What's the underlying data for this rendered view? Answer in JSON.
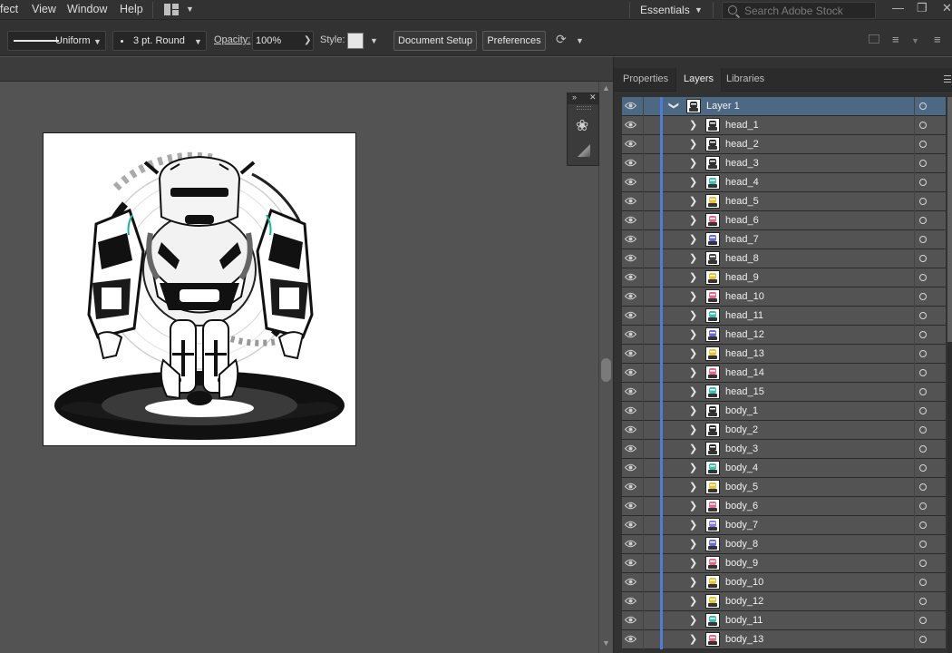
{
  "menubar": {
    "items": [
      "fect",
      "View",
      "Window",
      "Help"
    ],
    "workspace": "Essentials",
    "stock_search_placeholder": "Search Adobe Stock"
  },
  "control_bar": {
    "stroke_profile": "Uniform",
    "brush": "3 pt. Round",
    "opacity_label": "Opacity:",
    "opacity_value": "100%",
    "style_label": "Style:",
    "document_setup": "Document Setup",
    "preferences": "Preferences"
  },
  "panel": {
    "tabs": [
      "Properties",
      "Layers",
      "Libraries"
    ],
    "active_tab": "Layers",
    "layer_parent": "Layer 1",
    "sublayers": [
      "head_1",
      "head_2",
      "head_3",
      "head_4",
      "head_5",
      "head_6",
      "head_7",
      "head_8",
      "head_9",
      "head_10",
      "head_11",
      "head_12",
      "head_13",
      "head_14",
      "head_15",
      "body_1",
      "body_2",
      "body_3",
      "body_4",
      "body_5",
      "body_6",
      "body_7",
      "body_8",
      "body_9",
      "body_10",
      "body_12",
      "body_11",
      "body_13"
    ]
  },
  "colors": {
    "ui_dark": "#323232",
    "canvas": "#535353",
    "selection": "#4d6882",
    "layer_color": "#4e7dd6",
    "thumb_accents": [
      "#2c2c2c",
      "#2c2c2c",
      "#2c2c2c",
      "#3fbfb0",
      "#e8c23a",
      "#e36b8a",
      "#6b6bd6",
      "#444444",
      "#e8c23a",
      "#e36b8a",
      "#3fbfb0",
      "#6b6bd6",
      "#e8c23a",
      "#e36b8a",
      "#3fbfb0",
      "#2c2c2c",
      "#2c2c2c",
      "#2c2c2c",
      "#3fbfb0",
      "#e8c23a",
      "#e36b8a",
      "#8a7be0",
      "#6b6bd6",
      "#e36b8a",
      "#e8c23a",
      "#e8c23a",
      "#3fbfb0",
      "#e36b8a"
    ]
  }
}
